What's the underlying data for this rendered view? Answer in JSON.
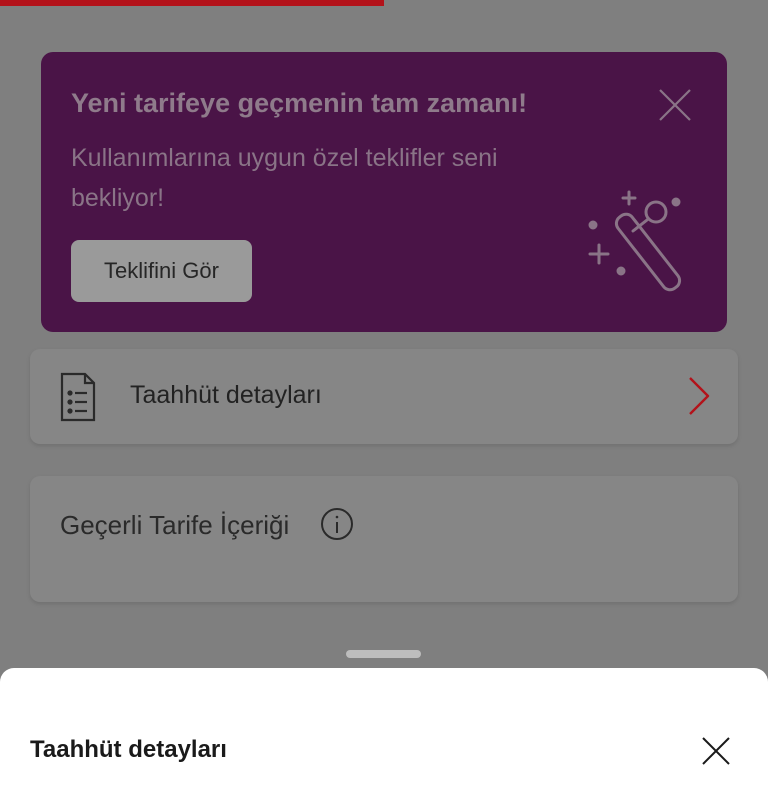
{
  "progress": {
    "value_percent": 50,
    "color": "#b3121a"
  },
  "promo": {
    "title": "Yeni tarifeye geçmenin tam zamanı!",
    "text": "Kullanımlarına uygun özel teklifler seni bekliyor!",
    "button_label": "Teklifini Gör",
    "close_icon": "close-icon",
    "illustration_icon": "magic-wand-icon",
    "background_color": "#4a1447"
  },
  "commitment_card": {
    "label": "Taahhüt detayları",
    "icon": "document-list-icon",
    "chevron_icon": "chevron-right-icon",
    "chevron_color": "#b3121a"
  },
  "tariff_card": {
    "label": "Geçerli Tarife İçeriği",
    "info_icon": "info-icon"
  },
  "bottom_sheet": {
    "title": "Taahhüt detayları",
    "close_icon": "close-icon"
  }
}
